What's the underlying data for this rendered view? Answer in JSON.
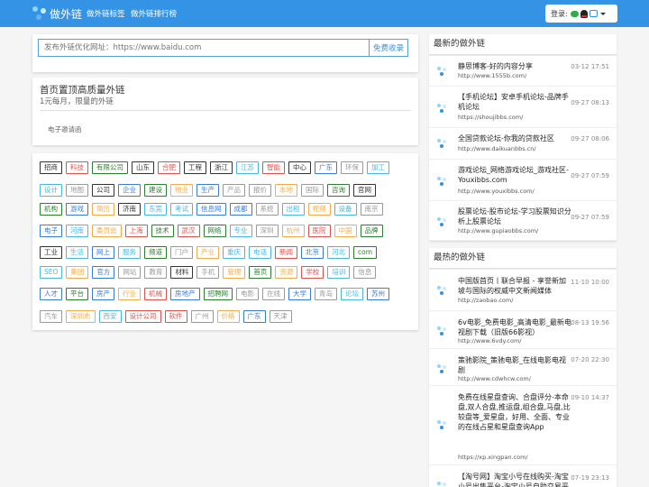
{
  "nav": {
    "brand": "做外链",
    "links": [
      "做外链标签",
      "做外链排行榜"
    ],
    "login_label": "登录:"
  },
  "search": {
    "placeholder": "发布外链优化网址：https://www.baidu.com",
    "button": "免费收录"
  },
  "promo": {
    "title": "首页置顶高质量外链",
    "subtitle": "1元每月，限量的外链",
    "items": [
      "电子邀请函"
    ]
  },
  "tags": [
    [
      [
        "招商",
        "#333"
      ],
      [
        "科技",
        "#d9534f"
      ],
      [
        "有限公司",
        "#2e7d32"
      ],
      [
        "山东",
        "#333"
      ],
      [
        "合肥",
        "#d9534f"
      ],
      [
        "工程",
        "#333"
      ],
      [
        "浙江",
        "#333"
      ],
      [
        "江苏",
        "#4db6e0"
      ],
      [
        "智能",
        "#d9534f"
      ],
      [
        "中心",
        "#333"
      ],
      [
        "广东",
        "#3a7bd5"
      ],
      [
        "环保",
        "#999"
      ],
      [
        "加工",
        "#4db6e0"
      ]
    ],
    [
      [
        "设计",
        "#4db6e0"
      ],
      [
        "地图",
        "#999"
      ],
      [
        "公司",
        "#333"
      ],
      [
        "企业",
        "#3a7bd5"
      ],
      [
        "建设",
        "#2e7d32"
      ],
      [
        "物业",
        "#f0ad4e"
      ],
      [
        "生产",
        "#3a7bd5"
      ],
      [
        "产品",
        "#999"
      ],
      [
        "报价",
        "#999"
      ],
      [
        "本地",
        "#f0ad4e"
      ],
      [
        "国际",
        "#999"
      ],
      [
        "咨询",
        "#2e7d32"
      ],
      [
        "官网",
        "#333"
      ]
    ],
    [
      [
        "机构",
        "#2e7d32"
      ],
      [
        "游戏",
        "#3a7bd5"
      ],
      [
        "简历",
        "#f0ad4e"
      ],
      [
        "济南",
        "#333"
      ],
      [
        "东莞",
        "#4db6e0"
      ],
      [
        "考试",
        "#4db6e0"
      ],
      [
        "信息网",
        "#3a7bd5"
      ],
      [
        "成都",
        "#3a7bd5"
      ],
      [
        "系统",
        "#999"
      ],
      [
        "出租",
        "#4db6e0"
      ],
      [
        "视频",
        "#f0ad4e"
      ],
      [
        "设备",
        "#4db6e0"
      ],
      [
        "南京",
        "#999"
      ]
    ],
    [
      [
        "电子",
        "#3a7bd5"
      ],
      [
        "河南",
        "#4db6e0"
      ],
      [
        "委员会",
        "#f0ad4e"
      ],
      [
        "上海",
        "#d9534f"
      ],
      [
        "技术",
        "#2e7d32"
      ],
      [
        "武汉",
        "#d9534f"
      ],
      [
        "网络",
        "#2e7d32"
      ],
      [
        "专业",
        "#4db6e0"
      ],
      [
        "深圳",
        "#999"
      ],
      [
        "杭州",
        "#f0ad4e"
      ],
      [
        "医院",
        "#d9534f"
      ],
      [
        "中国",
        "#f0ad4e"
      ],
      [
        "品牌",
        "#2e7d32"
      ]
    ],
    [
      [
        "工业",
        "#333"
      ],
      [
        "生活",
        "#4db6e0"
      ],
      [
        "网上",
        "#3a7bd5"
      ],
      [
        "服务",
        "#4db6e0"
      ],
      [
        "频道",
        "#2e7d32"
      ],
      [
        "门户",
        "#999"
      ],
      [
        "产业",
        "#f0ad4e"
      ],
      [
        "重庆",
        "#4db6e0"
      ],
      [
        "电话",
        "#4db6e0"
      ],
      [
        "新闻",
        "#d9534f"
      ],
      [
        "北京",
        "#3a7bd5"
      ],
      [
        "河北",
        "#4db6e0"
      ],
      [
        "com",
        "#2e7d32"
      ]
    ],
    [
      [
        "SEO",
        "#4db6e0"
      ],
      [
        "集团",
        "#f0ad4e"
      ],
      [
        "官方",
        "#3a7bd5"
      ],
      [
        "网站",
        "#999"
      ],
      [
        "教育",
        "#999"
      ],
      [
        "材料",
        "#333"
      ],
      [
        "手机",
        "#999"
      ],
      [
        "管理",
        "#f0ad4e"
      ],
      [
        "首页",
        "#2e7d32"
      ],
      [
        "资源",
        "#f0ad4e"
      ],
      [
        "学校",
        "#d9534f"
      ],
      [
        "培训",
        "#4db6e0"
      ],
      [
        "信息",
        "#999"
      ]
    ],
    [
      [
        "人才",
        "#3a7bd5"
      ],
      [
        "平台",
        "#2e7d32"
      ],
      [
        "房产",
        "#3a7bd5"
      ],
      [
        "行业",
        "#f0ad4e"
      ],
      [
        "机械",
        "#d9534f"
      ],
      [
        "房地产",
        "#3a7bd5"
      ],
      [
        "招聘网",
        "#2e7d32"
      ],
      [
        "电影",
        "#999"
      ],
      [
        "在线",
        "#999"
      ],
      [
        "大学",
        "#3a7bd5"
      ],
      [
        "青岛",
        "#999"
      ],
      [
        "论坛",
        "#4db6e0"
      ],
      [
        "苏州",
        "#3a7bd5"
      ]
    ],
    [
      [
        "汽车",
        "#999"
      ],
      [
        "深圳市",
        "#f0ad4e"
      ],
      [
        "西安",
        "#4db6e0"
      ],
      [
        "设计公司",
        "#d9534f"
      ],
      [
        "软件",
        "#d9534f"
      ],
      [
        "广州",
        "#999"
      ],
      [
        "价格",
        "#f0ad4e"
      ],
      [
        "广东",
        "#3a7bd5"
      ],
      [
        "天津",
        "#999"
      ]
    ]
  ],
  "sidebar": {
    "latest_title": "最新的做外链",
    "latest": [
      {
        "title": "静思博客-好的内容分享",
        "url": "http://www.1555b.com/",
        "time": "03-12 17:51"
      },
      {
        "title": "【手机论坛】安卓手机论坛-品牌手机论坛",
        "url": "https://shoujibbs.com/",
        "time": "09-27 08:13"
      },
      {
        "title": "全国贷款论坛-你我的贷款社区",
        "url": "http://www.daikuanbbs.cn/",
        "time": "09-27 08:06"
      },
      {
        "title": "游戏论坛_网络游戏论坛_游戏社区-Youxibbs.com",
        "url": "http://www.youxibbs.com/",
        "time": "09-27 07:59"
      },
      {
        "title": "股票论坛-股市论坛-学习股票知识分析上股票论坛",
        "url": "http://www.gupiaobbs.com/",
        "time": "09-27 07:59"
      }
    ],
    "hot_title": "最热的做外链",
    "hot": [
      {
        "title": "中国版首页丨联合早报 - 享誉新加坡与国际的权威中文新闻媒体",
        "url": "http://zaobao.com/",
        "time": "11-10 10:00"
      },
      {
        "title": "6v电影_免费电影_高清电影_最新电视剧下载（旧版66影视）",
        "url": "http://www.6vdy.com/",
        "time": "08-13 19:56"
      },
      {
        "title": "策驰影院_策驰电影_在线电影电视剧",
        "url": "http://www.cdwhcw.com/",
        "time": "07-20 22:30"
      },
      {
        "title": "免费在线星盘查询、合盘评分-本命盘,双人合盘,推运盘,组合盘,马盘,比较盘等_爱星盘，好用、全面、专业的在线占星和星盘查询App",
        "url": "https://xp.xingpan.com/",
        "time": "09-10 14:37"
      },
      {
        "title": "【淘号网】淘宝小号在线购买-淘宝小号出售平台-淘宝小号自助交易平台",
        "url": "",
        "time": "07-19 23:13"
      }
    ]
  },
  "colors": {
    "nav_bg": "#3593e6",
    "accent": "#3593e6"
  }
}
